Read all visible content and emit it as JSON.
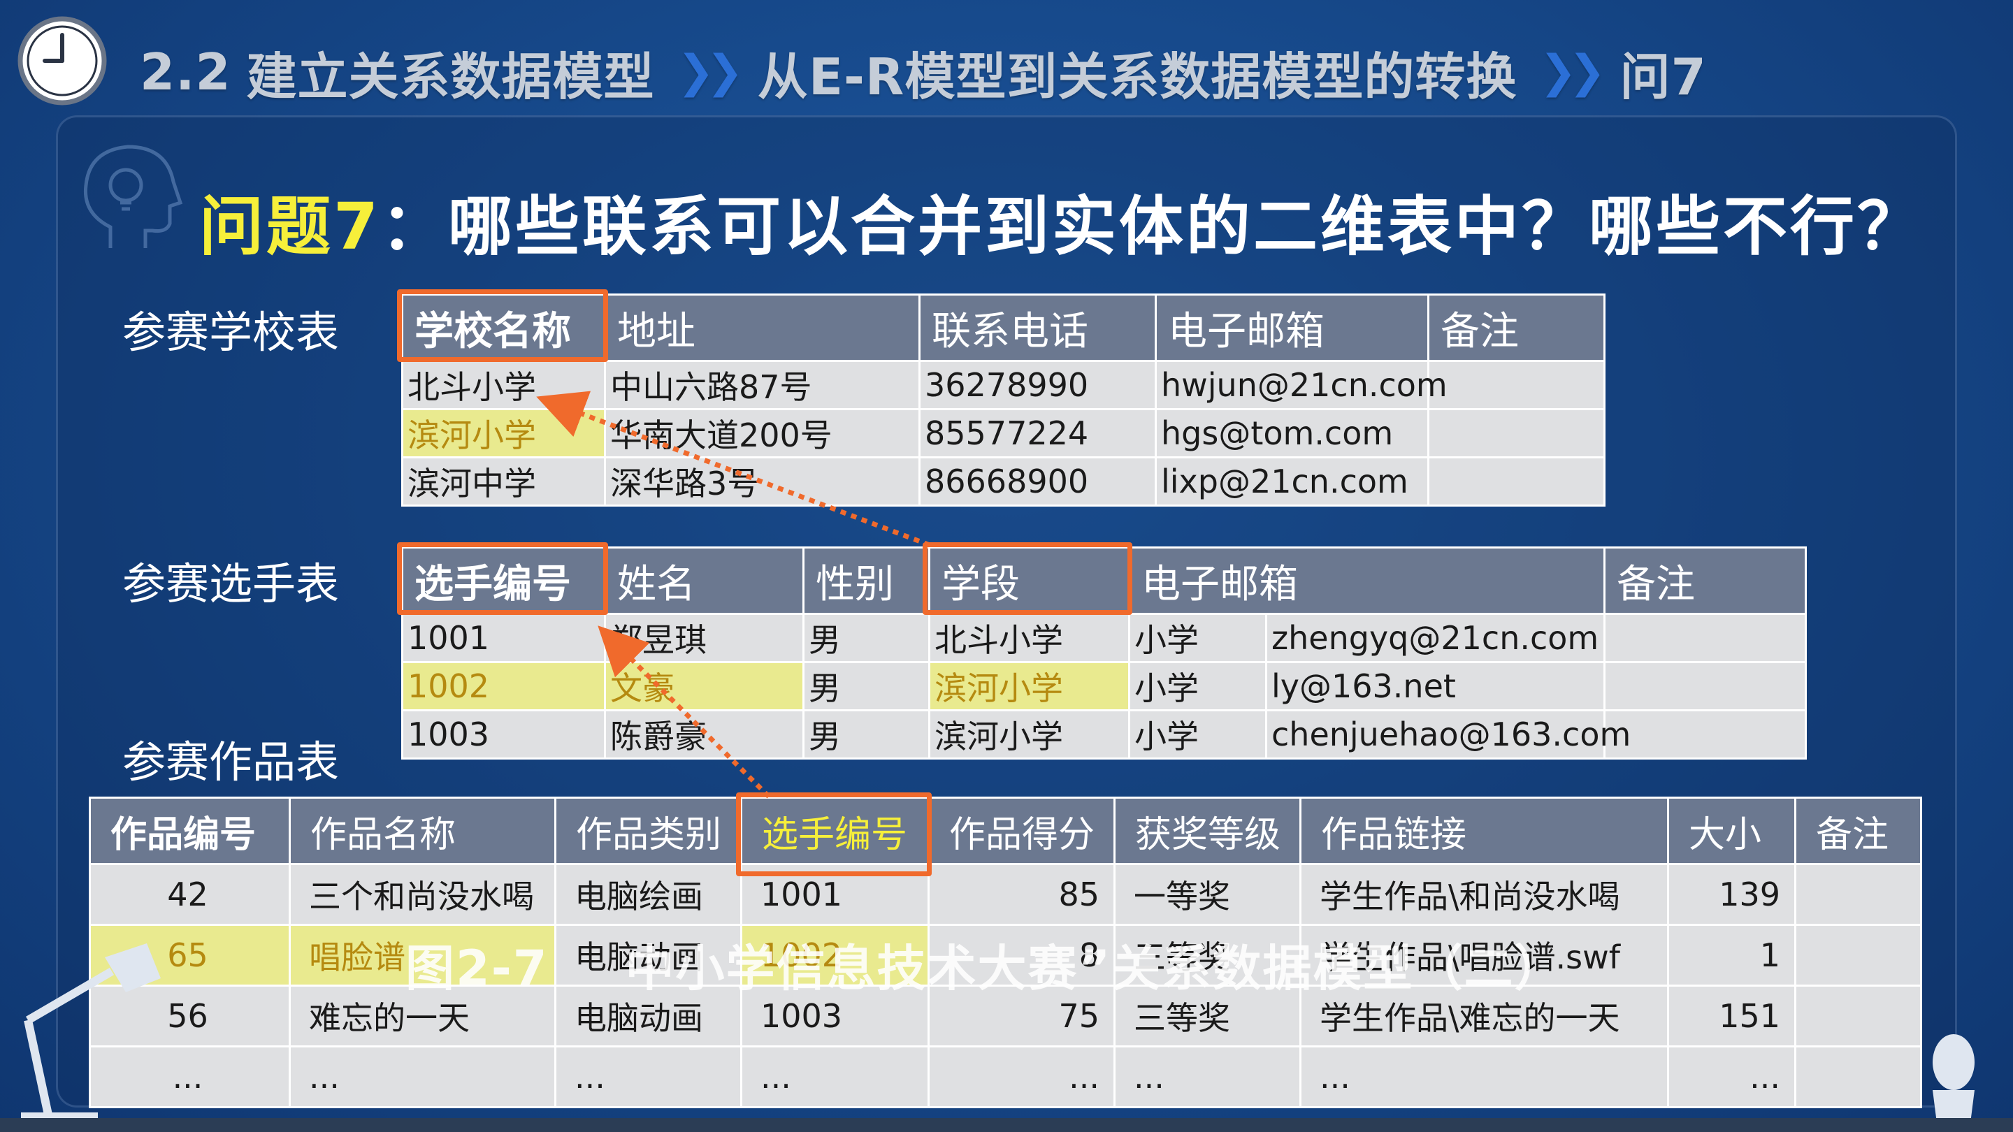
{
  "header": {
    "section": "2.2",
    "crumbs": [
      "建立关系数据模型",
      "从E-R模型到关系数据模型的转换",
      "问7"
    ]
  },
  "question": {
    "label": "问题7",
    "text": "：哪些联系可以合并到实体的二维表中？哪些不行？"
  },
  "school_table": {
    "caption": "参赛学校表",
    "headers": [
      "学校名称",
      "地址",
      "联系电话",
      "电子邮箱",
      "备注"
    ],
    "rows": [
      [
        "北斗小学",
        "中山六路87号",
        "36278990",
        "hwjun@21cn.com",
        ""
      ],
      [
        "滨河小学",
        "华南大道200号",
        "85577224",
        "hgs@tom.com",
        ""
      ],
      [
        "滨河中学",
        "深华路3号",
        "86668900",
        "lixp@21cn.com",
        ""
      ]
    ]
  },
  "player_table": {
    "caption": "参赛选手表",
    "headers": [
      "选手编号",
      "姓名",
      "性别",
      "学段",
      "电子邮箱",
      "备注"
    ],
    "rows": [
      [
        "1001",
        "郑昱琪",
        "男",
        "北斗小学",
        "小学",
        "zhengyq@21cn.com",
        ""
      ],
      [
        "1002",
        "文豪",
        "男",
        "滨河小学",
        "小学",
        "ly@163.net",
        ""
      ],
      [
        "1003",
        "陈爵豪",
        "男",
        "滨河小学",
        "小学",
        "chenjuehao@163.com",
        ""
      ]
    ]
  },
  "works_table": {
    "caption": "参赛作品表",
    "headers": [
      "作品编号",
      "作品名称",
      "作品类别",
      "选手编号",
      "作品得分",
      "获奖等级",
      "作品链接",
      "大小",
      "备注"
    ],
    "rows": [
      [
        "42",
        "三个和尚没水喝",
        "电脑绘画",
        "1001",
        "85",
        "一等奖",
        "学生作品\\和尚没水喝",
        "139",
        ""
      ],
      [
        "65",
        "唱脸谱",
        "电脑动画",
        "1002",
        "8",
        "三等奖",
        "学生作品\\唱脸谱.swf",
        "1",
        ""
      ],
      [
        "56",
        "难忘的一天",
        "电脑动画",
        "1003",
        "75",
        "三等奖",
        "学生作品\\难忘的一天",
        "151",
        ""
      ],
      [
        "...",
        "...",
        "...",
        "...",
        "...",
        "...",
        "...",
        "...",
        ""
      ]
    ]
  },
  "figure_caption": {
    "number": "图2-7",
    "title": "中小学信息技术大赛”关系数据模型（二）"
  },
  "colors": {
    "background": "#174a8c",
    "highlight_row": "#e9ea8f",
    "highlight_box": "#f06a2c",
    "question_label": "#f6ef3a"
  }
}
